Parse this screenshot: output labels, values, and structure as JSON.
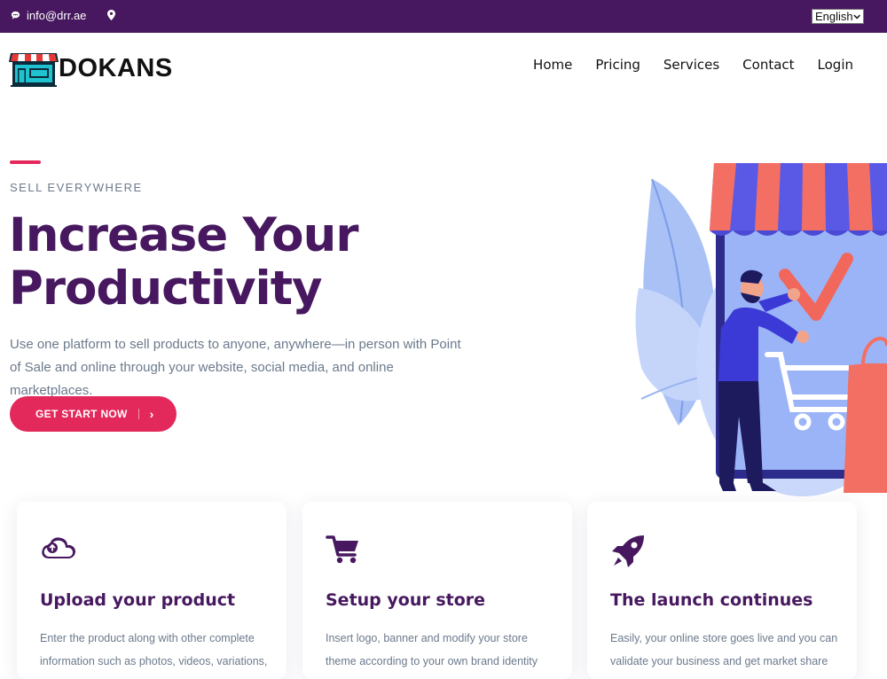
{
  "topbar": {
    "email": "info@drr.ae",
    "language": "English"
  },
  "header": {
    "logo_text": "DOKANS",
    "nav": [
      "Home",
      "Pricing",
      "Services",
      "Contact",
      "Login"
    ]
  },
  "hero": {
    "eyebrow": "SELL EVERYWHERE",
    "title_line1": "Increase Your",
    "title_line2": "Productivity",
    "subtitle": "Use one platform to sell products to anyone, anywhere—in person with Point of Sale and online through your website, social media, and online marketplaces.",
    "cta_label": "GET START NOW",
    "cta_chevron": "›"
  },
  "features": [
    {
      "icon": "cloud-upload-icon",
      "title": "Upload your product",
      "text": "Enter the product along with other complete information such as photos, videos, variations,"
    },
    {
      "icon": "shopping-cart-icon",
      "title": "Setup your store",
      "text": "Insert logo, banner and modify your store theme according to your own brand identity"
    },
    {
      "icon": "rocket-icon",
      "title": "The launch continues",
      "text": "Easily, your online store goes live and you can validate your business and get market share"
    }
  ],
  "colors": {
    "brand_purple": "#47185f",
    "accent_pink": "#e3285b",
    "muted_text": "#6b7a8c"
  }
}
